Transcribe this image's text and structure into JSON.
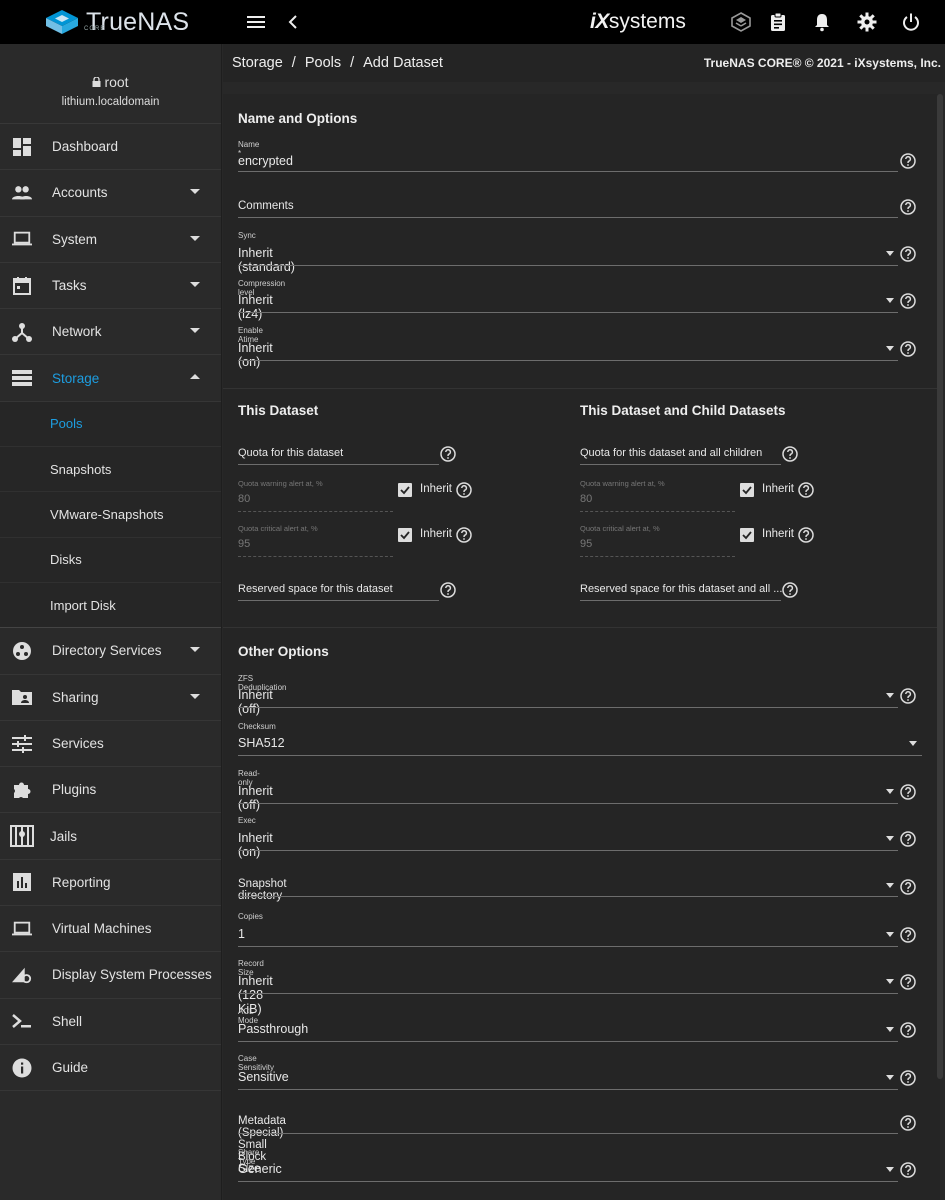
{
  "header": {
    "logo_text": "TrueNAS",
    "logo_sub": "CORE",
    "brand_ix": "iX",
    "brand_systems": "systems"
  },
  "user": {
    "name": "root",
    "host": "lithium.localdomain"
  },
  "sidebar": {
    "items": [
      {
        "label": "Dashboard"
      },
      {
        "label": "Accounts"
      },
      {
        "label": "System"
      },
      {
        "label": "Tasks"
      },
      {
        "label": "Network"
      },
      {
        "label": "Storage"
      },
      {
        "label": "Directory Services"
      },
      {
        "label": "Sharing"
      },
      {
        "label": "Services"
      },
      {
        "label": "Plugins"
      },
      {
        "label": "Jails"
      },
      {
        "label": "Reporting"
      },
      {
        "label": "Virtual Machines"
      },
      {
        "label": "Display System Processes"
      },
      {
        "label": "Shell"
      },
      {
        "label": "Guide"
      }
    ],
    "storage_sub": [
      {
        "label": "Pools"
      },
      {
        "label": "Snapshots"
      },
      {
        "label": "VMware-Snapshots"
      },
      {
        "label": "Disks"
      },
      {
        "label": "Import Disk"
      }
    ]
  },
  "breadcrumb": {
    "a": "Storage",
    "b": "Pools",
    "c": "Add Dataset",
    "sep": "/"
  },
  "copyright": "TrueNAS CORE® © 2021 - iXsystems, Inc.",
  "form": {
    "name_options_title": "Name and Options",
    "name_label": "Name *",
    "name_value": "encrypted",
    "comments_label": "Comments",
    "sync_label": "Sync",
    "sync_value": "Inherit (standard)",
    "compression_label": "Compression level",
    "compression_value": "Inherit (lz4)",
    "atime_label": "Enable Atime",
    "atime_value": "Inherit (on)",
    "this_dataset_title": "This Dataset",
    "child_title": "This Dataset and Child Datasets",
    "quota_label": "Quota for this dataset",
    "quota_children_label": "Quota for this dataset and all children",
    "warn_label": "Quota warning alert at, %",
    "warn_value": "80",
    "crit_label": "Quota critical alert at, %",
    "crit_value": "95",
    "inherit_label": "Inherit",
    "reserved_label": "Reserved space for this dataset",
    "reserved_children_label": "Reserved space for this dataset and all ...",
    "other_title": "Other Options",
    "dedup_label": "ZFS Deduplication",
    "dedup_value": "Inherit (off)",
    "checksum_label": "Checksum",
    "checksum_value": "SHA512",
    "readonly_label": "Read-only",
    "readonly_value": "Inherit (off)",
    "exec_label": "Exec",
    "exec_value": "Inherit (on)",
    "snapdir_label": "Snapshot directory",
    "copies_label": "Copies",
    "copies_value": "1",
    "recordsize_label": "Record Size",
    "recordsize_value": "Inherit (128 KiB)",
    "acl_label": "ACL Mode",
    "acl_value": "Passthrough",
    "case_label": "Case Sensitivity",
    "case_value": "Sensitive",
    "metadata_label": "Metadata (Special) Small Block Size",
    "share_label": "Share Type",
    "share_value": "Generic"
  },
  "colors": {
    "accent": "#1d9de0",
    "topbar": "#000000",
    "background": "#282828"
  }
}
